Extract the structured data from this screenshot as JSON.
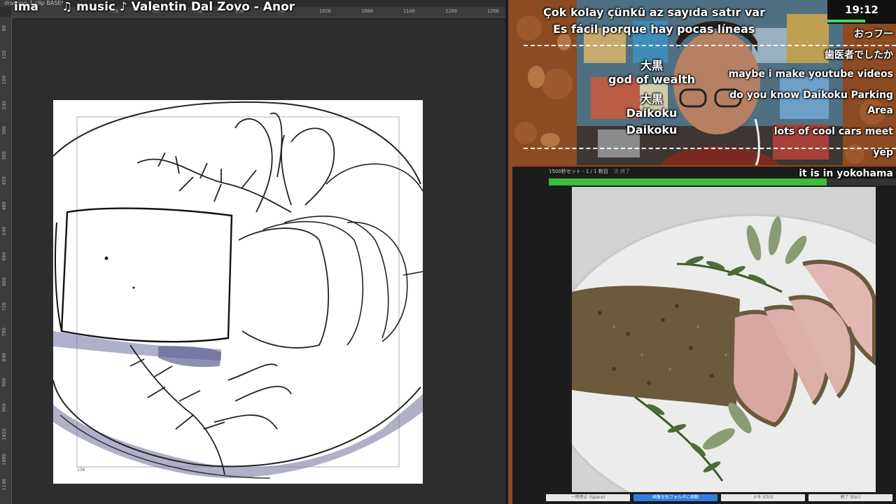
{
  "app": {
    "document_tab": "drawing_1.clip BASE*",
    "overlay_title": "ima",
    "overlay_music": "♫ music ♪ Valentin Dal Zovo - Anor",
    "ruler_top_ticks": [
      "720",
      "780",
      "840",
      "900",
      "960",
      "1020",
      "1080",
      "1140",
      "1200",
      "1260",
      "1320"
    ],
    "ruler_left_ticks": [
      "60",
      "120",
      "180",
      "240",
      "300",
      "360",
      "420",
      "480",
      "540",
      "600",
      "660",
      "720",
      "780",
      "840",
      "900",
      "960",
      "1020",
      "1080",
      "1140"
    ],
    "canvas_corner_label": "136"
  },
  "stream": {
    "subtitles": [
      "Çok kolay çünkü az sayıda satır var",
      "Es fácil porque hay pocas líneas"
    ],
    "translation_lines": [
      "大黒",
      "god of wealth",
      "大黒",
      "Daikoku",
      "Daikoku"
    ],
    "clock": "19:12",
    "clock_progress": 0.55,
    "chat": [
      "おっフー",
      "歯医者でしたか",
      "maybe i make youtube videos",
      "do you know Daikoku Parking",
      "Area",
      "lots of cool cars meet",
      "yep",
      "it is in yokohama"
    ]
  },
  "reference_app": {
    "header": "1500秒セット - 1 / 1 枚目",
    "header_right": "次 終了",
    "progress": 0.8,
    "buttons": [
      "一時停止 (Space)",
      "画像を別フォルダに移動",
      "メモ (Ctrl)",
      "終了 (Esc)"
    ]
  },
  "colors": {
    "progress_green": "#3dbb3d",
    "button_blue": "#2f7de1",
    "clock_green": "#4cd65a",
    "sketch_wash": "#6d6f9e"
  }
}
